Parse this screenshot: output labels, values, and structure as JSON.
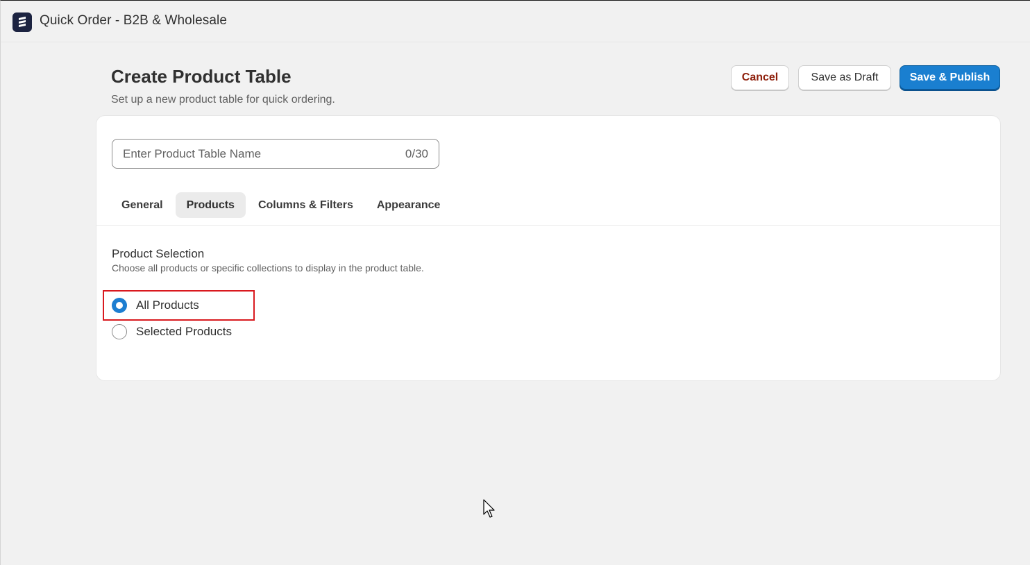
{
  "app": {
    "title": "Quick Order - B2B & Wholesale",
    "logo_icon": "stack-logo-icon"
  },
  "page": {
    "title": "Create Product Table",
    "subtitle": "Set up a new product table for quick ordering."
  },
  "actions": {
    "cancel_label": "Cancel",
    "draft_label": "Save as Draft",
    "publish_label": "Save & Publish"
  },
  "name_field": {
    "placeholder": "Enter Product Table Name",
    "value": "",
    "char_count": "0/30"
  },
  "tabs": [
    {
      "label": "General",
      "active": false
    },
    {
      "label": "Products",
      "active": true
    },
    {
      "label": "Columns & Filters",
      "active": false
    },
    {
      "label": "Appearance",
      "active": false
    }
  ],
  "product_selection": {
    "title": "Product Selection",
    "description": "Choose all products or specific collections to display in the product table.",
    "options": [
      {
        "label": "All Products",
        "checked": true
      },
      {
        "label": "Selected Products",
        "checked": false
      }
    ]
  },
  "colors": {
    "primary": "#1a7fd0",
    "cancel_text": "#8e1f0b",
    "highlight": "#d9191f",
    "background": "#f1f1f1"
  }
}
